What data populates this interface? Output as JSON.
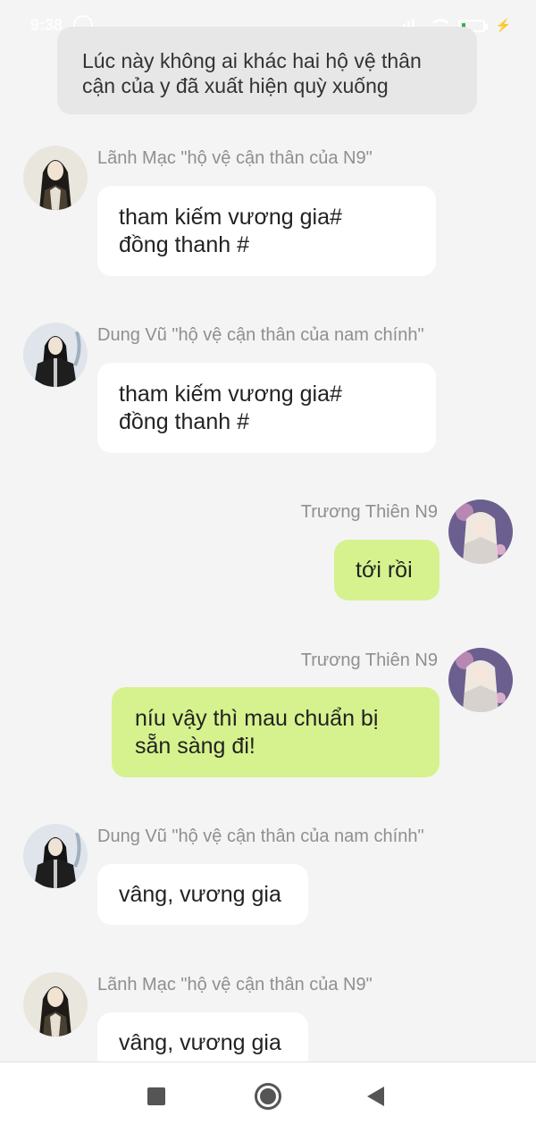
{
  "status_bar": {
    "time": "9:38",
    "icons": [
      "face-icon",
      "signal-icon",
      "wifi-icon",
      "battery-icon",
      "charging-icon"
    ],
    "battery_label": "11"
  },
  "system_message": {
    "line1": "Lúc này không ai khác hai hộ vệ thân",
    "line2": "cận của y đã xuất hiện quỳ xuống"
  },
  "messages": [
    {
      "sender": "Lãnh Mạc \"hộ vệ cận thân của N9\"",
      "lines": [
        "tham kiếm vương gia#",
        "đồng thanh #"
      ],
      "side": "left"
    },
    {
      "sender": "Dung Vũ \"hộ vệ cận thân của nam chính\"",
      "lines": [
        "tham kiếm vương gia#",
        "đồng thanh #"
      ],
      "side": "left"
    },
    {
      "sender": "Trương Thiên N9",
      "lines": [
        "tới rồi"
      ],
      "side": "right"
    },
    {
      "sender": "Trương Thiên N9",
      "lines": [
        "níu vậy thì mau chuẩn bị",
        "sẵn sàng đi!"
      ],
      "side": "right"
    },
    {
      "sender": "Dung Vũ \"hộ vệ cận thân của nam chính\"",
      "lines": [
        "vâng, vương gia"
      ],
      "side": "left"
    },
    {
      "sender": "Lãnh Mạc \"hộ vệ cận thân của N9\"",
      "lines": [
        "vâng, vương gia"
      ],
      "side": "left"
    }
  ],
  "colors": {
    "background": "#f4f4f4",
    "incoming_bubble": "#ffffff",
    "outgoing_bubble": "#d6f28e",
    "system_bubble": "#e7e7e7",
    "sender_text": "#8f8f8f"
  },
  "nav_bar": {
    "buttons": [
      "recents-square-icon",
      "home-circle-icon",
      "back-triangle-icon"
    ]
  }
}
